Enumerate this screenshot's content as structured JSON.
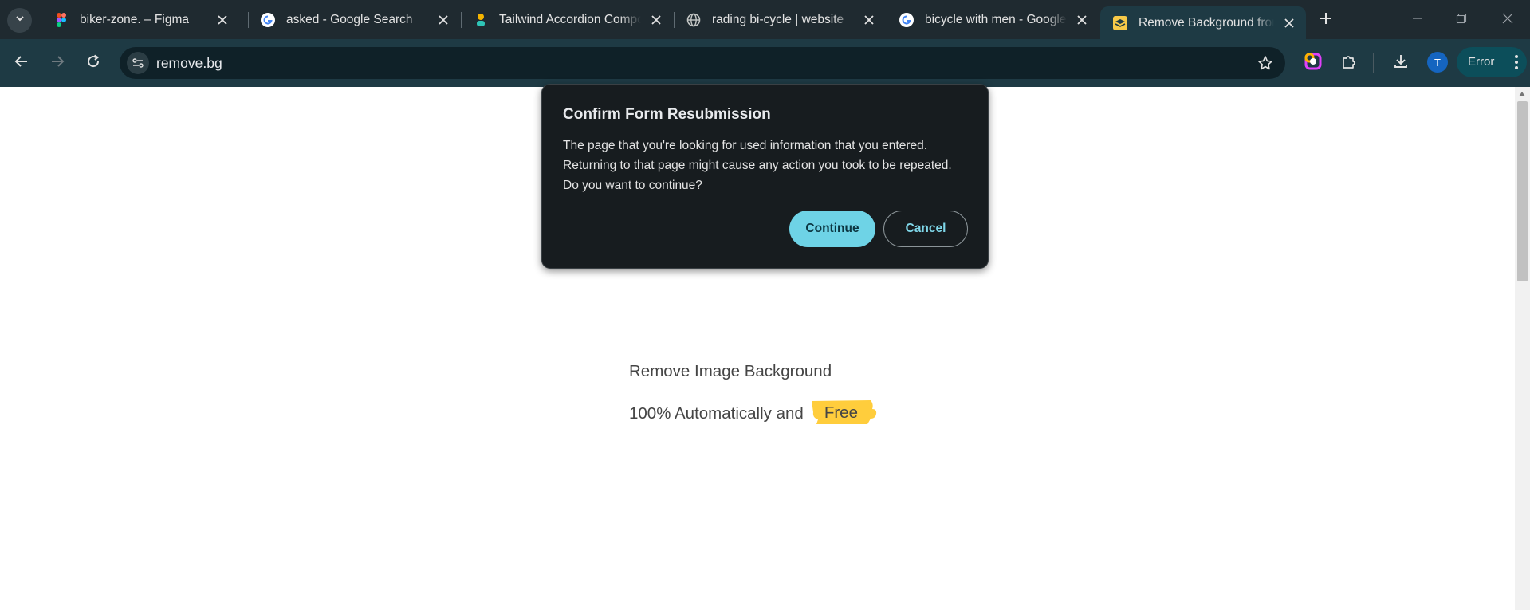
{
  "browser": {
    "tabs": [
      {
        "title": "biker-zone. – Figma",
        "favicon": "figma-icon"
      },
      {
        "title": "asked - Google Search",
        "favicon": "google-icon"
      },
      {
        "title": "Tailwind Accordion Components",
        "favicon": "tailwind-icon"
      },
      {
        "title": "rading bi-cycle | website",
        "favicon": "globe-icon"
      },
      {
        "title": "bicycle with men - Google Search",
        "favicon": "google-icon"
      },
      {
        "title": "Remove Background from Image",
        "favicon": "removebg-icon",
        "active": true
      }
    ],
    "url": "remove.bg",
    "profile_initial": "T",
    "error_label": "Error"
  },
  "page": {
    "hero_line1": "Remove Image Background",
    "hero_line2": "100% Automatically and",
    "badge": "Free",
    "badge_color": "#ffcd3c"
  },
  "dialog": {
    "title": "Confirm Form Resubmission",
    "body": "The page that you're looking for used information that you entered. Returning to that page might cause any action you took to be repeated. Do you want to continue?",
    "continue_label": "Continue",
    "cancel_label": "Cancel"
  },
  "colors": {
    "tabstrip_bg": "#1f2a30",
    "toolbar_bg": "#1e3a44",
    "continue_button": "#6ed3e6"
  }
}
